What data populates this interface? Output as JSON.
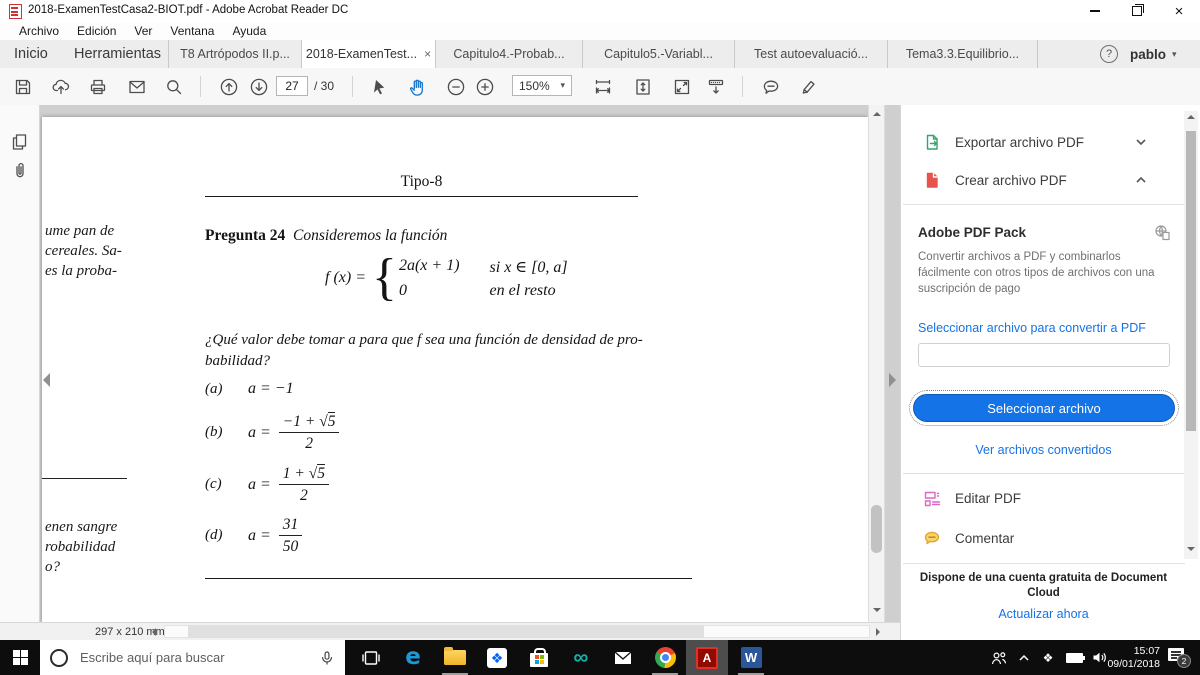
{
  "window": {
    "title": "2018-ExamenTestCasa2-BIOT.pdf - Adobe Acrobat Reader DC",
    "menu_items": [
      "Archivo",
      "Edición",
      "Ver",
      "Ventana",
      "Ayuda"
    ]
  },
  "nav": {
    "home": "Inicio",
    "tools": "Herramientas",
    "doc_tabs": [
      {
        "label": "T8 Artrópodos II.p..."
      },
      {
        "label": "2018-ExamenTest...",
        "active": true
      },
      {
        "label": "Capitulo4.-Probab..."
      },
      {
        "label": "Capitulo5.-Variabl..."
      },
      {
        "label": "Test autoevaluació..."
      },
      {
        "label": "Tema3.3.Equilibrio..."
      }
    ],
    "user": "pablo"
  },
  "toolbar": {
    "page_current": "27",
    "page_total": "/ 30",
    "zoom_level": "150%"
  },
  "document": {
    "header": "Tipo-8",
    "question_number": "Pregunta 24",
    "question_intro": "Consideremos la función",
    "function_lhs": "f (x) =",
    "cases": [
      {
        "expr": "2a(x + 1)",
        "cond": "si x ∈ [0, a]"
      },
      {
        "expr": "0",
        "cond": "en el resto"
      }
    ],
    "question_line1": "¿Qué valor debe tomar a para que f sea una función de densidad de pro-",
    "question_line2": "babilidad?",
    "answers": [
      {
        "label": "(a)",
        "value": "a = −1"
      },
      {
        "label": "(b)",
        "lhs": "a =",
        "num_pre": "−1 +",
        "radicand": "5",
        "den": "2"
      },
      {
        "label": "(c)",
        "lhs": "a =",
        "num_pre": "1 +",
        "radicand": "5",
        "den": "2"
      },
      {
        "label": "(d)",
        "lhs": "a =",
        "num": "31",
        "den": "50"
      }
    ],
    "fragments_top": [
      "ume pan de",
      "cereales. Sa-",
      "es la proba-"
    ],
    "fragments_bottom": [
      "enen sangre",
      "robabilidad",
      "o?"
    ],
    "page_size": "297 x 210 mm"
  },
  "panel": {
    "export_label": "Exportar archivo PDF",
    "create_label": "Crear archivo PDF",
    "pack_title": "Adobe PDF Pack",
    "pack_description": "Convertir archivos a PDF y combinarlos fácilmente con otros tipos de archivos con una suscripción de pago",
    "convert_link": "Seleccionar archivo para convertir a PDF",
    "select_button": "Seleccionar archivo",
    "converted_link": "Ver archivos convertidos",
    "edit_label": "Editar PDF",
    "comment_label": "Comentar",
    "cloud_promo_line1": "Dispone de una cuenta gratuita de Document",
    "cloud_promo_line2": "Cloud",
    "upgrade_link": "Actualizar ahora"
  },
  "taskbar": {
    "search_placeholder": "Escribe aquí para buscar",
    "time": "15:07",
    "date": "09/01/2018",
    "notification_count": "2"
  },
  "icons": {
    "close_tab": "×",
    "close_window": "×",
    "help": "?",
    "caret_down": "▾",
    "brace": "{",
    "sqrt": "√",
    "edge": "e",
    "infinity": "∞",
    "dropbox": "❖",
    "acrobat": "A",
    "word": "W"
  },
  "colors": {
    "accent_blue": "#1473e6",
    "export_green": "#35a46d",
    "create_red": "#e5544d",
    "edit_magenta": "#df66c3",
    "comment_yellow": "#f3c13a",
    "hand_blue": "#1274cc"
  }
}
